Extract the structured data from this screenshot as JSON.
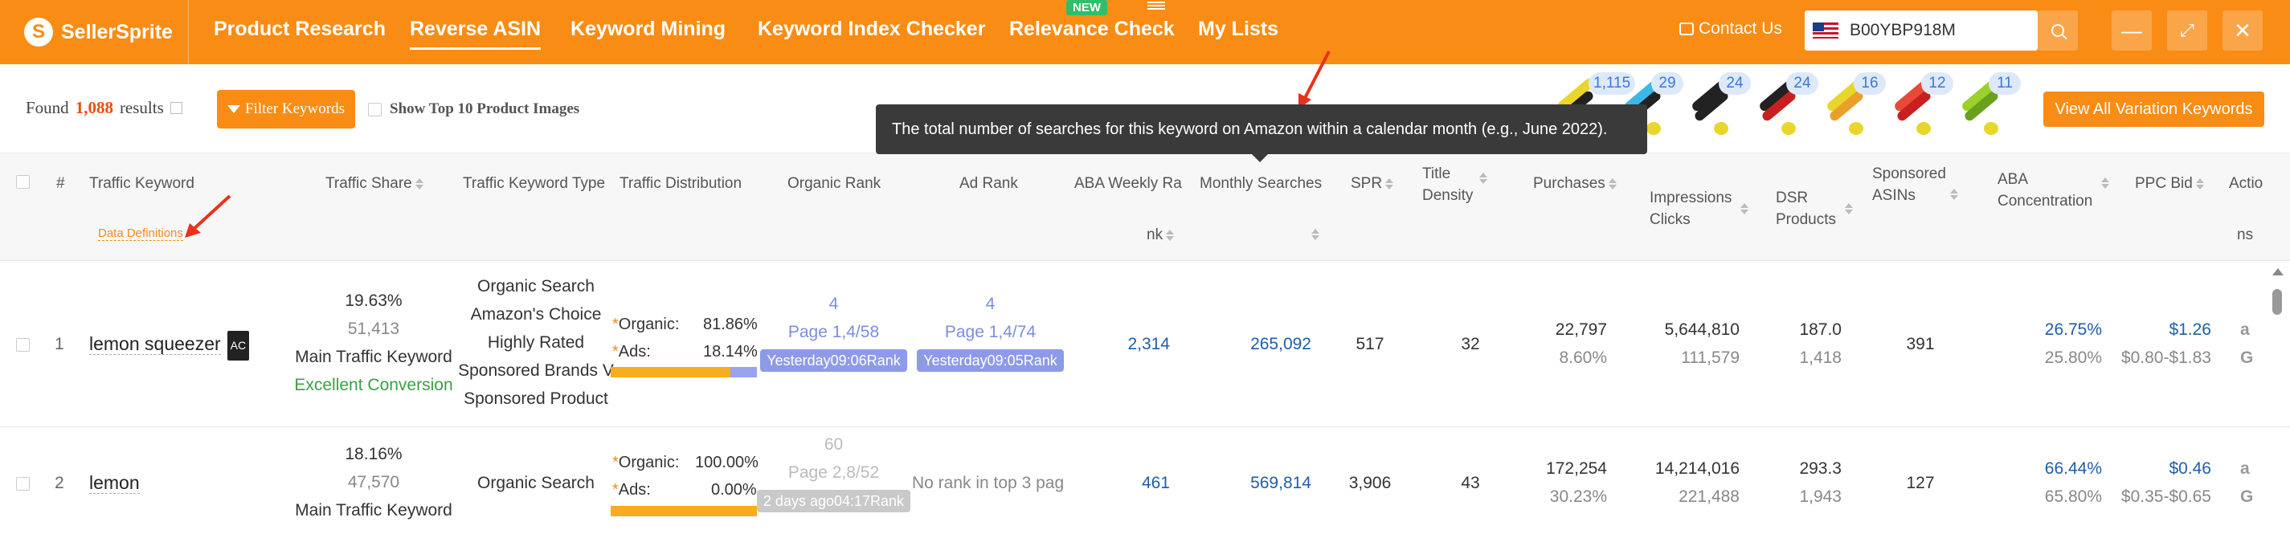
{
  "brand": {
    "name": "SellerSprite",
    "mark": "S"
  },
  "nav": {
    "items": [
      "Product Research",
      "Reverse ASIN",
      "Keyword Mining",
      "Keyword Index Checker",
      "Relevance Check",
      "My Lists"
    ],
    "active": "Reverse ASIN",
    "new_badge": "NEW",
    "contact_label": "Contact Us",
    "search_value": "B00YBP918M",
    "accent_color": "#f98c14"
  },
  "toolbar": {
    "found_prefix": "Found",
    "found_count": "1,088",
    "found_suffix": "results",
    "filter_label": "Filter Keywords",
    "show_top_label": "Show Top 10 Product Images",
    "variation_label": "View All Variation Keywords",
    "variation_counts": [
      "1,115",
      "29",
      "24",
      "24",
      "16",
      "12",
      "11"
    ]
  },
  "tooltip": {
    "text": "The total number of searches for this keyword on Amazon within a calendar month (e.g., June 2022)."
  },
  "table": {
    "headers": {
      "index": "#",
      "keyword": "Traffic Keyword",
      "data_definitions": "Data Definitions",
      "traffic_share": "Traffic Share",
      "keyword_type": "Traffic Keyword Type",
      "distribution": "Traffic Distribution",
      "organic_rank": "Organic Rank",
      "ad_rank": "Ad Rank",
      "aba_weekly_1": "ABA Weekly Ra",
      "aba_weekly_2": "nk",
      "monthly_searches": "Monthly Searches",
      "spr": "SPR",
      "title_density_1": "Title",
      "title_density_2": "Density",
      "purchases": "Purchases",
      "impressions": "Impressions",
      "clicks": "Clicks",
      "dsr_1": "DSR",
      "dsr_2": "Products",
      "sponsored_1": "Sponsored",
      "sponsored_2": "ASINs",
      "aba_conc_1": "ABA",
      "aba_conc_2": "Concentration",
      "ppc_bid": "PPC Bid",
      "actions_1": "Actio",
      "actions_2": "ns"
    },
    "rows": [
      {
        "index": "1",
        "keyword": "lemon squeezer",
        "badge": "AC",
        "share_pct": "19.63%",
        "share_count": "51,413",
        "share_tag": "Main Traffic Keyword",
        "share_tag2": "Excellent Conversion",
        "types": [
          "Organic Search",
          "Amazon's Choice",
          "Highly Rated",
          "Sponsored Brands V",
          "Sponsored Product"
        ],
        "organic_label": "Organic:",
        "organic_pct": "81.86%",
        "organic_frac": 0.8186,
        "ads_label": "Ads:",
        "ads_pct": "18.14%",
        "organic_rank": "4",
        "organic_page": "Page 1,4/58",
        "organic_when": "Yesterday09:06Rank",
        "ad_rank": "4",
        "ad_page": "Page 1,4/74",
        "ad_when": "Yesterday09:05Rank",
        "aba_weekly": "2,314",
        "monthly_searches": "265,092",
        "spr": "517",
        "title_density": "32",
        "purchases": "22,797",
        "purchase_rate": "8.60%",
        "impressions": "5,644,810",
        "clicks": "111,579",
        "dsr": "187.0",
        "products": "1,418",
        "sponsored_asins": "391",
        "aba_conc": "26.75%",
        "aba_conc2": "25.80%",
        "ppc_bid": "$1.26",
        "ppc_range": "$0.80-$1.83"
      },
      {
        "index": "2",
        "keyword": "lemon",
        "share_pct": "18.16%",
        "share_count": "47,570",
        "share_tag": "Main Traffic Keyword",
        "types": [
          "Organic Search"
        ],
        "organic_label": "Organic:",
        "organic_pct": "100.00%",
        "organic_frac": 1.0,
        "ads_label": "Ads:",
        "ads_pct": "0.00%",
        "organic_rank": "60",
        "organic_page": "Page 2,8/52",
        "organic_when": "2 days ago04:17Rank",
        "ad_none": "No rank in top 3 pag",
        "aba_weekly": "461",
        "monthly_searches": "569,814",
        "spr": "3,906",
        "title_density": "43",
        "purchases": "172,254",
        "purchase_rate": "30.23%",
        "impressions": "14,214,016",
        "clicks": "221,488",
        "dsr": "293.3",
        "products": "1,943",
        "sponsored_asins": "127",
        "aba_conc": "66.44%",
        "aba_conc2": "65.80%",
        "ppc_bid": "$0.46",
        "ppc_range": "$0.35-$0.65"
      }
    ]
  }
}
